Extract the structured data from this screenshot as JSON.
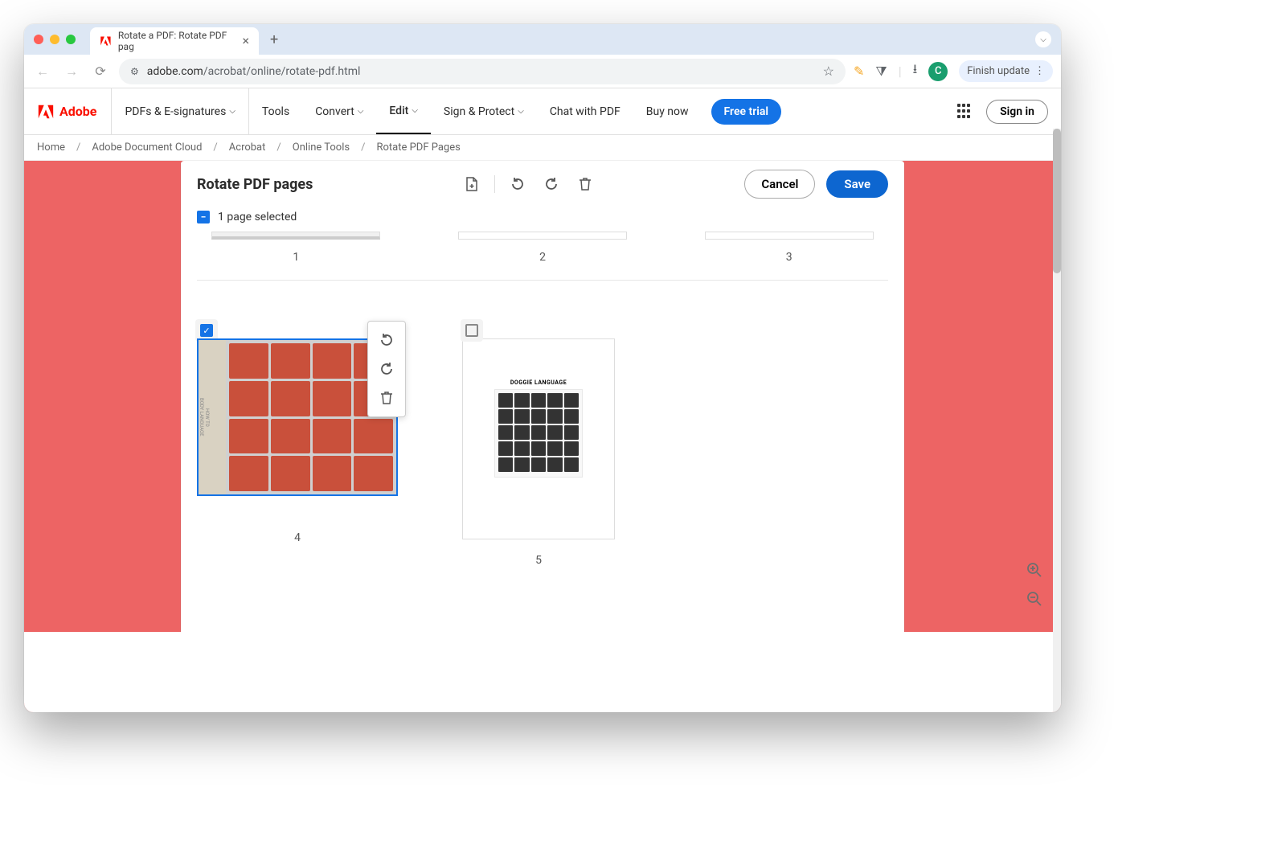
{
  "browser": {
    "tab_title": "Rotate a PDF: Rotate PDF pag",
    "url_domain": "adobe.com",
    "url_path": "/acrobat/online/rotate-pdf.html",
    "finish_update": "Finish update",
    "avatar_letter": "C"
  },
  "adobe_nav": {
    "brand": "Adobe",
    "items": [
      "PDFs & E-signatures",
      "Tools",
      "Convert",
      "Edit",
      "Sign & Protect",
      "Chat with PDF",
      "Buy now"
    ],
    "free_trial": "Free trial",
    "sign_in": "Sign in"
  },
  "breadcrumb": [
    "Home",
    "Adobe Document Cloud",
    "Acrobat",
    "Online Tools",
    "Rotate PDF Pages"
  ],
  "panel": {
    "title": "Rotate PDF pages",
    "cancel": "Cancel",
    "save": "Save",
    "selection_text": "1 page selected"
  },
  "pages": {
    "row1": [
      "1",
      "2",
      "3"
    ],
    "row2": [
      "4",
      "5"
    ]
  },
  "thumb4": {
    "sidebar_line1": "HOW TO",
    "sidebar_line2": "BODY LANGUAGE"
  },
  "thumb5": {
    "poster_title": "DOGGIE LANGUAGE"
  }
}
